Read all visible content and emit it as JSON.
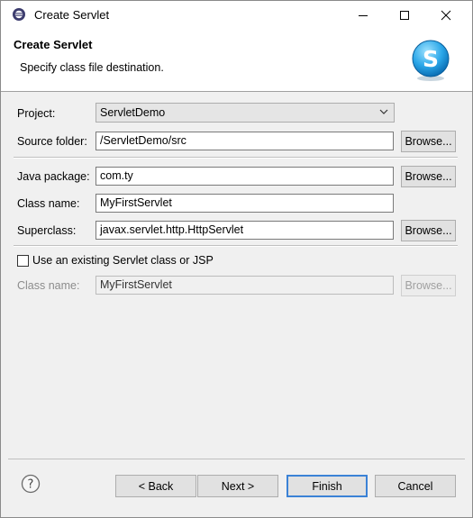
{
  "window": {
    "title": "Create Servlet",
    "controls": [
      "minimize-icon",
      "maximize-icon",
      "close-icon"
    ]
  },
  "banner": {
    "title": "Create Servlet",
    "description": "Specify class file destination.",
    "logo_icon": "servlet-logo-icon"
  },
  "form": {
    "project": {
      "label": "Project:",
      "value": "ServletDemo"
    },
    "source_folder": {
      "label": "Source folder:",
      "value": "/ServletDemo/src",
      "browse": "Browse..."
    },
    "java_package": {
      "label": "Java package:",
      "value": "com.ty",
      "browse": "Browse..."
    },
    "class_name": {
      "label": "Class name:",
      "value": "MyFirstServlet"
    },
    "superclass": {
      "label": "Superclass:",
      "value": "javax.servlet.http.HttpServlet",
      "browse": "Browse..."
    },
    "use_existing": {
      "label": "Use an existing Servlet class or JSP",
      "checked": false
    },
    "existing_class": {
      "label": "Class name:",
      "value": "MyFirstServlet",
      "browse": "Browse..."
    }
  },
  "footer": {
    "help_icon": "help-icon",
    "back": "< Back",
    "next": "Next >",
    "finish": "Finish",
    "cancel": "Cancel"
  },
  "colors": {
    "primary_border": "#3b82d6",
    "dialog_bg": "#f0f0f0"
  }
}
